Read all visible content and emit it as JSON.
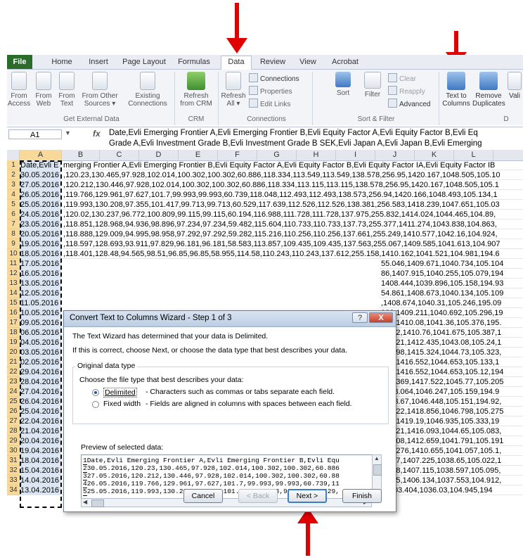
{
  "ribbon": {
    "tabs": [
      "File",
      "Home",
      "Insert",
      "Page Layout",
      "Formulas",
      "Data",
      "Review",
      "View",
      "Acrobat"
    ],
    "active_tab": "Data",
    "buttons": {
      "from_access": "From Access",
      "from_web": "From Web",
      "from_text": "From Text",
      "from_other": "From Other Sources ▾",
      "existing": "Existing Connections",
      "refresh_crm": "Refresh from CRM",
      "refresh_all": "Refresh All ▾",
      "connections": "Connections",
      "properties": "Properties",
      "edit_links": "Edit Links",
      "sort_az": "A↓Z",
      "sort": "Sort",
      "filter": "Filter",
      "clear": "Clear",
      "reapply": "Reapply",
      "advanced": "Advanced",
      "text_to_columns": "Text to Columns",
      "remove_duplicates": "Remove Duplicates",
      "validation": "Vali"
    },
    "groups": [
      "Get External Data",
      "CRM",
      "Connections",
      "Sort & Filter",
      "D"
    ]
  },
  "formula_bar": {
    "name_box": "A1",
    "fx": "fx",
    "line1": "Date,Evli Emerging Frontier A,Evli Emerging Frontier B,Evli Equity Factor A,Evli Equity Factor B,Evli Eq",
    "line2": "Grade A,Evli Investment Grade B,Evli Investment Grade B SEK,Evli Japan A,Evli Japan B,Evli Emerging"
  },
  "grid": {
    "columns": [
      "A",
      "B",
      "C",
      "D",
      "E",
      "F",
      "G",
      "H",
      "I",
      "J",
      "K",
      "L"
    ],
    "rows": [
      {
        "n": "1",
        "a": "Date,Evli E",
        "rest": "merging Frontier A,Evli Emerging Frontier B,Evli Equity Factor A,Evli Equity Factor B,Evli Equity Factor IA,Evli Equity Factor IB"
      },
      {
        "n": "2",
        "a": "30.05.2016",
        "rest": ",120.23,130.465,97.928,102.014,100.302,100.302,60.886,118.334,113.549,113.549,138.578,256.95,1420.167,1048.505,105.10"
      },
      {
        "n": "3",
        "a": "27.05.2016",
        "rest": ",120.212,130.446,97.928,102.014,100.302,100.302,60.886,118.334,113.115,113.115,138.578,256.95,1420.167,1048.505,105.1"
      },
      {
        "n": "4",
        "a": "26.05.2016",
        "rest": ",119.766,129.961,97.627,101.7,99.993,99.993,60.739,118.048,112.493,112.493,138.573,256.94,1420.166,1048.493,105.134,1"
      },
      {
        "n": "5",
        "a": "25.05.2016",
        "rest": ",119.993,130.208,97.355,101.417,99.713,99.713,60.529,117.639,112.526,112.526,138.381,256.583,1418.239,1047.651,105.03"
      },
      {
        "n": "6",
        "a": "24.05.2016",
        "rest": ",120.02,130.237,96.772,100.809,99.115,99.115,60.194,116.988,111.728,111.728,137.975,255.832,1414.024,1044.465,104.89,"
      },
      {
        "n": "7",
        "a": "23.05.2016",
        "rest": ",118.851,128.968,94.936,98.896,97.234,97.234,59.482,115.604,110.733,110.733,137.73,255.377,1411.274,1043.838,104.863,"
      },
      {
        "n": "8",
        "a": "20.05.2016",
        "rest": ",118.888,129.009,94.995,98.958,97.292,97.292,59.282,115.216,110.256,110.256,137.661,255.249,1410.577,1042.16,104.924,"
      },
      {
        "n": "9",
        "a": "19.05.2016",
        "rest": ",118.597,128.693,93.911,97.829,96.181,96.181,58.583,113.857,109.435,109.435,137.563,255.067,1409.585,1041.613,104.907"
      },
      {
        "n": "10",
        "a": "18.05.2016",
        "rest": ",118.401,128.48,94.565,98.51,96.85,96.85,58.955,114.58,110.243,110.243,137.612,255.158,1410.162,1041.521,104.981,194.6"
      },
      {
        "n": "11",
        "a": "17.05.2016",
        "rest": "55.046,1409.671,1040.734,105.104"
      },
      {
        "n": "12",
        "a": "16.05.2016",
        "rest": "86,1407.915,1040.255,105.079,194"
      },
      {
        "n": "13",
        "a": "13.05.2016",
        "rest": "1408.444,1039.896,105.158,194.93"
      },
      {
        "n": "14",
        "a": "12.05.2016",
        "rest": "54.861,1408.673,1040.134,105.109"
      },
      {
        "n": "15",
        "a": "11.05.2016",
        "rest": ",1408.674,1040.31,105.246,195.09"
      },
      {
        "n": "16",
        "a": "10.05.2016",
        "rest": "923,1409.211,1040.692,105.296,19"
      },
      {
        "n": "17",
        "a": "09.05.2016",
        "rest": "081,1410.08,1041.36,105.376,195."
      },
      {
        "n": "18",
        "a": "06.05.2016",
        "rest": "5.192,1410.76,1041.675,105.387,1"
      },
      {
        "n": "19",
        "a": "04.05.2016",
        "rest": "55.521,1412.435,1043.08,105.24,1"
      },
      {
        "n": "20",
        "a": "03.05.2016",
        "rest": "55.998,1415.324,1044.73,105.323,"
      },
      {
        "n": "21",
        "a": "02.05.2016",
        "rest": "205,1416.552,1044.653,105.133,1"
      },
      {
        "n": "22",
        "a": "29.04.2016",
        "rest": "205,1416.552,1044.653,105.12,194"
      },
      {
        "n": "23",
        "a": "28.04.2016",
        "rest": "256.369,1417.522,1045.77,105.205"
      },
      {
        "n": "24",
        "a": "27.04.2016",
        "rest": "1418.064,1046.247,105.159,194.9"
      },
      {
        "n": "25",
        "a": "26.04.2016",
        "rest": "1418.67,1046.448,105.151,194.92,"
      },
      {
        "n": "26",
        "a": "25.04.2016",
        "rest": "56.622,1418.856,1046.798,105.275"
      },
      {
        "n": "27",
        "a": "22.04.2016",
        "rest": "678,1419.19,1046.935,105.333,19"
      },
      {
        "n": "28",
        "a": "21.04.2016",
        "rest": "56.121,1416.093,1044.65,105.083,"
      },
      {
        "n": "29",
        "a": "20.04.2016",
        "rest": "55.508,1412.659,1041.791,105.191"
      },
      {
        "n": "30",
        "a": "19.04.2016",
        "rest": "255.276,1410.655,1041.057,105.1,"
      },
      {
        "n": "31",
        "a": "18.04.2016",
        "rest": "4.657,1407.225,1038.65,105.022,1"
      },
      {
        "n": "32",
        "a": "15.04.2016",
        "rest": "4.628,1407.115,1038.597,105.095,"
      },
      {
        "n": "33",
        "a": "14.04.2016",
        "rest": "4.445,1406.134,1037.553,104.912,"
      },
      {
        "n": "34",
        "a": "13.04.2016",
        "rest": ",119.492,129.665,95.142,99.112,97.413,97.413,59.221,115.097,11   9,116.79,136.972,253.971,1403.404,1036.03,104.945,194"
      }
    ]
  },
  "dialog": {
    "title": "Convert Text to Columns Wizard - Step 1 of 3",
    "help": "?",
    "close": "X",
    "line1": "The Text Wizard has determined that your data is Delimited.",
    "line2": "If this is correct, choose Next, or choose the data type that best describes your data.",
    "group_label": "Original data type",
    "choose_label": "Choose the file type that best describes your data:",
    "delimited_label": "Delimited",
    "delimited_desc": "- Characters such as commas or tabs separate each field.",
    "fixed_label": "Fixed width",
    "fixed_desc": "- Fields are aligned in columns with spaces between each field.",
    "preview_label": "Preview of selected data:",
    "preview": [
      {
        "n": "1",
        "text": "Date,Evli Emerging Frontier A,Evli Emerging Frontier B,Evli Equ"
      },
      {
        "n": "2",
        "text": "30.05.2016,120.23,130.465,97.928,102.014,100.302,100.302,60.886"
      },
      {
        "n": "3",
        "text": "27.05.2016,120.212,130.446,97.928,102.014,100.302,100.302,60.88"
      },
      {
        "n": "4",
        "text": "26.05.2016,119.766,129.961,97.627,101.7,99.993,99.993,60.739,11"
      },
      {
        "n": "5",
        "text": "25.05.2016,119.993,130.208,97.355,101.417,99.713,99.713,60.529,"
      }
    ],
    "cancel": "Cancel",
    "back": "< Back",
    "next": "Next >",
    "finish": "Finish"
  },
  "colors": {
    "arrow": "#e00000",
    "file_tab": "#2b6c2b",
    "selection": "#dbe5f1",
    "header_highlight": "#f9d99a"
  }
}
